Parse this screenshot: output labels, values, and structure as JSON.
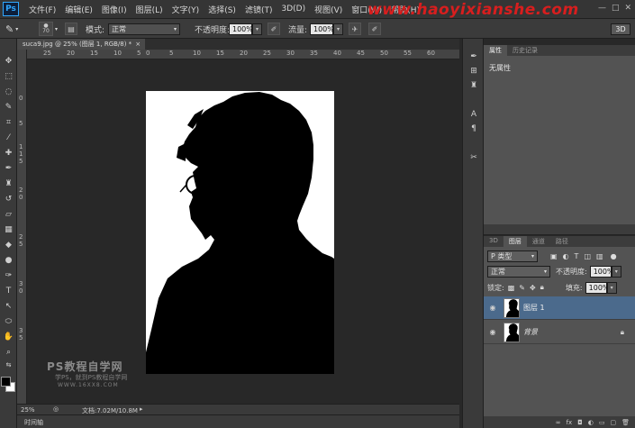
{
  "menu": {
    "app_logo": "Ps",
    "items": [
      "文件(F)",
      "编辑(E)",
      "图像(I)",
      "图层(L)",
      "文字(Y)",
      "选择(S)",
      "滤镜(T)",
      "3D(D)",
      "视图(V)",
      "窗口(W)",
      "帮助(H)"
    ],
    "watermark": "www.haoyixianshe.com"
  },
  "options": {
    "brush_size": "70",
    "mode_label": "模式:",
    "mode_value": "正常",
    "opacity_label": "不透明度:",
    "opacity_value": "100%",
    "flow_label": "流量:",
    "flow_value": "100%",
    "workspace": "3D"
  },
  "document": {
    "tab_label": "suca9.jpg @ 25% (图层 1, RGB/8) *",
    "tab_close": "×",
    "ruler_top": [
      "25",
      "20",
      "15",
      "10",
      "5",
      "0",
      "5",
      "10",
      "15",
      "20",
      "25",
      "30",
      "35",
      "40",
      "45",
      "50",
      "55",
      "60"
    ],
    "ruler_left": [
      "0",
      "5",
      "1",
      "1",
      "5",
      "2",
      "0",
      "2",
      "5",
      "3",
      "0",
      "3",
      "5"
    ]
  },
  "canvas_watermark": {
    "title": "PS教程自学网",
    "line1": "学PS，就到PS教程自学网",
    "line2": "WWW.16XX8.COM"
  },
  "status": {
    "zoom": "25%",
    "doc_info": "文档:7.02M/10.8M",
    "timeline": "时间轴"
  },
  "properties_panel": {
    "tabs": [
      "属性",
      "历史记录"
    ],
    "content": "无属性"
  },
  "layers_panel": {
    "tabs": [
      "3D",
      "图层",
      "通道",
      "路径"
    ],
    "filter_label": "P 类型",
    "blend_mode": "正常",
    "opacity_label": "不透明度:",
    "opacity_value": "100%",
    "lock_label": "锁定:",
    "fill_label": "填充:",
    "fill_value": "100%",
    "layers": [
      {
        "name": "图层 1",
        "selected": true
      },
      {
        "name": "背景",
        "selected": false
      }
    ]
  },
  "colors": {
    "foreground": "#000000",
    "background": "#ffffff",
    "selected_layer": "#4b6a8c",
    "watermark_red": "#d81e1e"
  }
}
